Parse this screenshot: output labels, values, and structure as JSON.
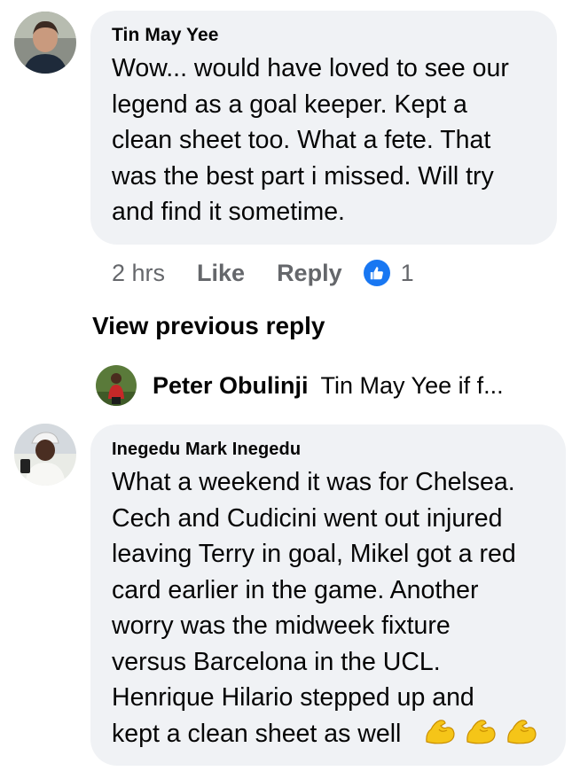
{
  "comment1": {
    "author": "Tin May Yee",
    "lines": [
      "Wow... would have loved to see our",
      "legend as a goal keeper. Kept a",
      "clean sheet too. What a fete. That",
      "was the best part i missed. Will try",
      "and find it sometime."
    ],
    "time": "2 hrs",
    "like_label": "Like",
    "reply_label": "Reply",
    "reaction_count": "1"
  },
  "view_previous_reply": "View previous reply",
  "reply_preview": {
    "author": "Peter Obulinji",
    "snippet": "Tin May Yee if f..."
  },
  "comment2": {
    "author": "Inegedu Mark Inegedu",
    "lines": [
      "What a weekend it was for Chelsea.",
      "Cech and Cudicini went out injured",
      "leaving Terry in goal, Mikel got a red",
      "card earlier in the game. Another",
      "worry was the midweek fixture",
      "versus Barcelona in the UCL.",
      "Henrique Hilario stepped up and",
      "kept a clean sheet as well"
    ],
    "emojis": [
      "flexed-biceps-emoji",
      "flexed-biceps-emoji",
      "flexed-biceps-emoji"
    ]
  },
  "colors": {
    "bubble": "#f0f2f5",
    "secondary_text": "#65676b",
    "like_blue": "#1877f2"
  }
}
